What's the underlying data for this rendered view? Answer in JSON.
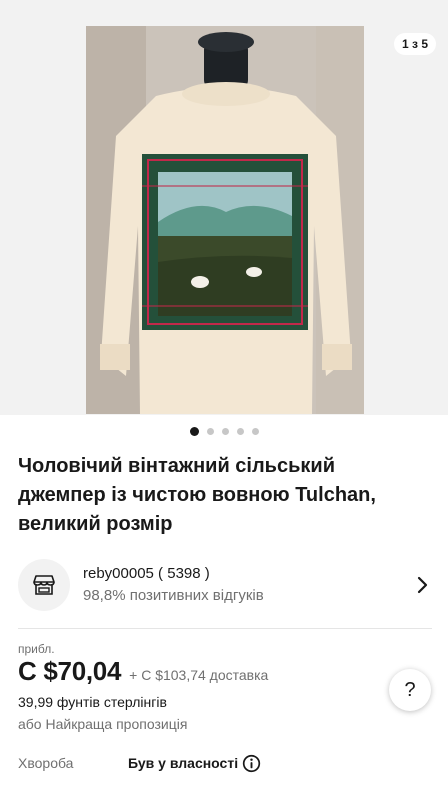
{
  "gallery": {
    "counter": "1 з 5",
    "image_subject": "photo-sweater",
    "dots_total": 5,
    "dots_active_index": 0
  },
  "listing": {
    "title": "Чоловічий вінтажний сільський джемпер із чистою вовною Tulchan, великий розмір"
  },
  "seller": {
    "name": "reby00005 ( 5398 )",
    "feedback": "98,8% позитивних відгуків",
    "avatar_icon": "store-icon",
    "chevron_icon": "chevron-right-icon"
  },
  "pricing": {
    "approx_label": "прибл.",
    "price": "C $70,04",
    "shipping": "+ C $103,74 доставка",
    "original_price": "39,99 фунтів стерлінгів",
    "best_offer": "або Найкраща пропозиція"
  },
  "help": {
    "label": "?"
  },
  "condition": {
    "label": "Хвороба",
    "value": "Був у власності",
    "info_icon": "info-icon"
  },
  "colors": {
    "text": "#191919",
    "muted": "#707070",
    "gallery_bg": "#f2f2f2"
  }
}
